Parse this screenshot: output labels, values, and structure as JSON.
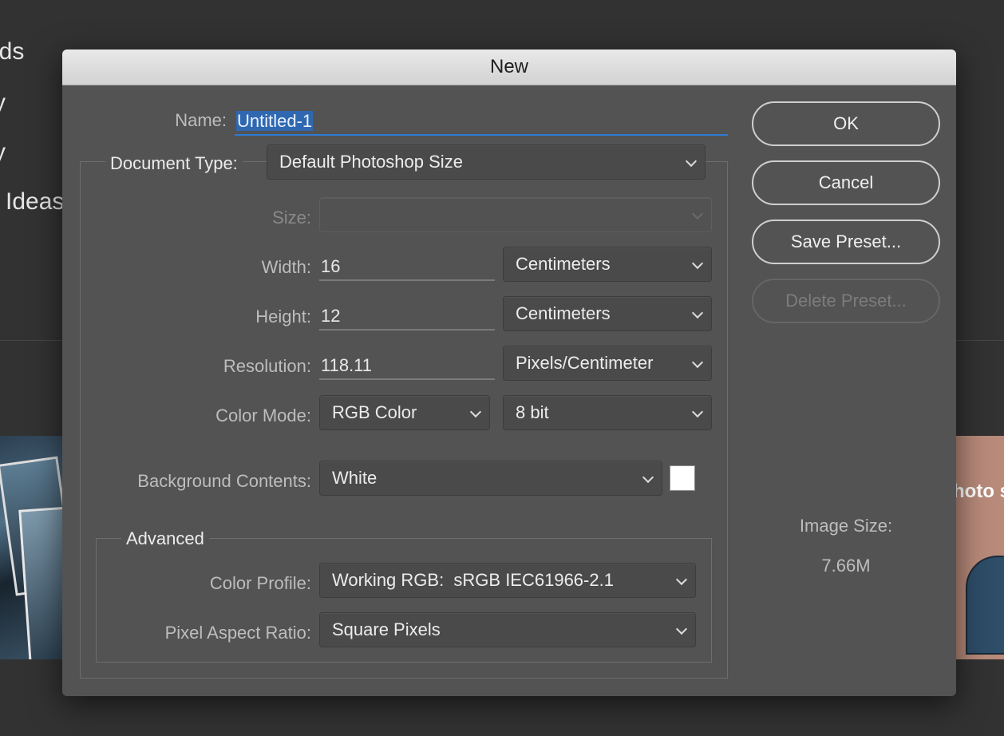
{
  "background": {
    "menu_items": [
      "nds",
      "ry",
      "ry",
      "g Ideas"
    ],
    "thumb_right_text": "hoto s"
  },
  "dialog": {
    "title": "New",
    "name_label": "Name:",
    "name_value": "Untitled-1",
    "document_type_label": "Document Type:",
    "document_type_value": "Default Photoshop Size",
    "size_label": "Size:",
    "size_value": "",
    "width_label": "Width:",
    "width_value": "16",
    "width_unit": "Centimeters",
    "height_label": "Height:",
    "height_value": "12",
    "height_unit": "Centimeters",
    "resolution_label": "Resolution:",
    "resolution_value": "118.11",
    "resolution_unit": "Pixels/Centimeter",
    "color_mode_label": "Color Mode:",
    "color_mode_value": "RGB Color",
    "bit_depth_value": "8 bit",
    "background_contents_label": "Background Contents:",
    "background_contents_value": "White",
    "background_swatch_color": "#ffffff",
    "advanced_label": "Advanced",
    "color_profile_label": "Color Profile:",
    "color_profile_value": "Working RGB:  sRGB IEC61966-2.1",
    "pixel_aspect_label": "Pixel Aspect Ratio:",
    "pixel_aspect_value": "Square Pixels",
    "buttons": {
      "ok": "OK",
      "cancel": "Cancel",
      "save_preset": "Save Preset...",
      "delete_preset": "Delete Preset..."
    },
    "image_size_label": "Image Size:",
    "image_size_value": "7.66M"
  }
}
